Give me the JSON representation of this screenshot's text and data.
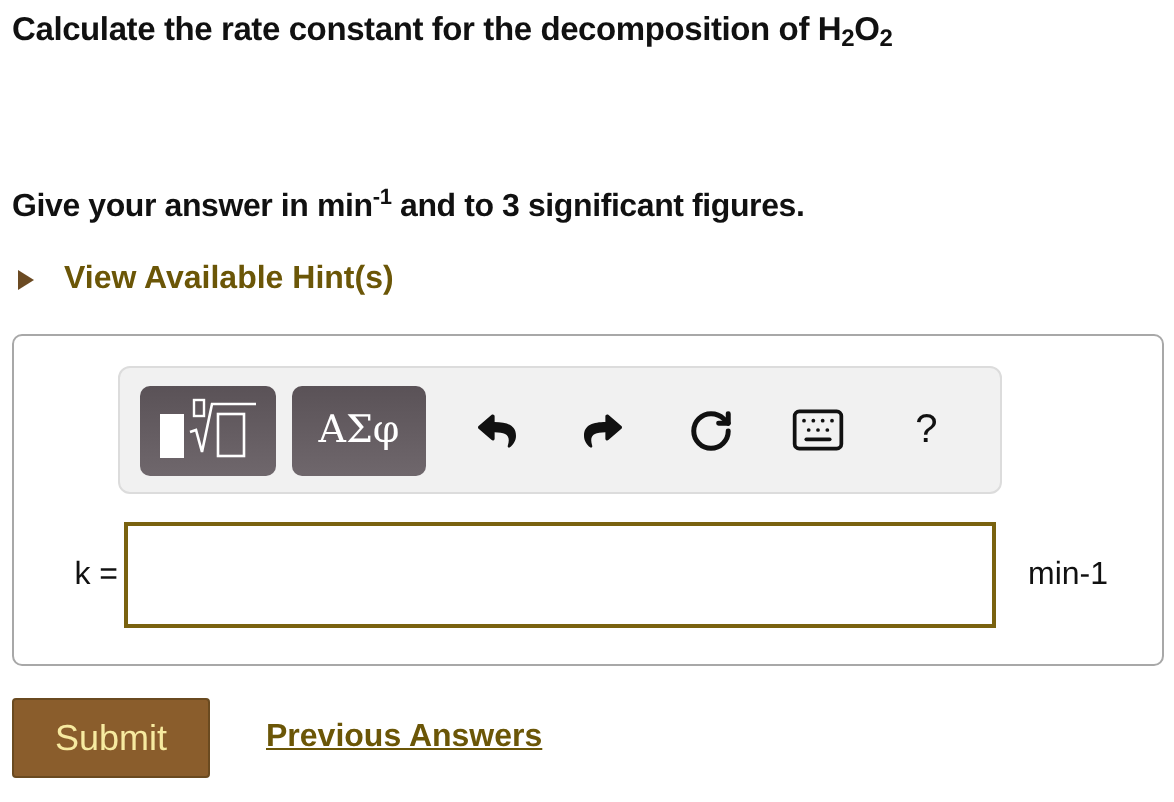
{
  "question": "Calculate the rate constant for the decomposition of H$_{2}$O$_{2}$",
  "instruction": "Give your answer in min$^{-1}$ and to 3 significant figures.",
  "hint_link": {
    "label": "View Available Hint(s)",
    "expanded": false
  },
  "toolbar": {
    "buttons": [
      {
        "kind": "templates"
      },
      {
        "kind": "symbols",
        "label": "ΑΣφ"
      },
      {
        "kind": "undo"
      },
      {
        "kind": "redo"
      },
      {
        "kind": "reset"
      },
      {
        "kind": "keyboard"
      },
      {
        "kind": "help",
        "label": "?"
      }
    ]
  },
  "answer": {
    "label": "k =",
    "unit": "min-1"
  },
  "submit": "Submit",
  "previous_answers": "Previous Answers"
}
